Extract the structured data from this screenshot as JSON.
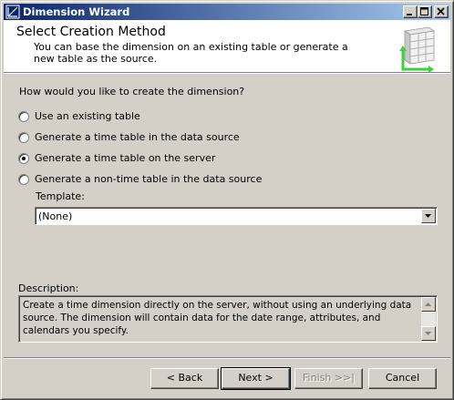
{
  "window": {
    "title": "Dimension Wizard",
    "title_gradient_start": "#0a246a",
    "title_gradient_end": "#a6caf0",
    "icons": [
      "app-icon",
      "minimize-icon",
      "maximize-icon",
      "close-icon"
    ]
  },
  "header": {
    "title": "Select Creation Method",
    "subtitle": "You can base the dimension on an existing table or generate a new table as the source.",
    "icon": "table-wizard-icon"
  },
  "main": {
    "question": "How would you like to create the dimension?",
    "options": [
      {
        "label": "Use an existing table",
        "checked": false
      },
      {
        "label": "Generate a time table in the data source",
        "checked": false
      },
      {
        "label": "Generate a time table on the server",
        "checked": true
      },
      {
        "label": "Generate a non-time table in the data source",
        "checked": false
      }
    ],
    "template_label": "Template:",
    "template_value": "(None)",
    "description_label": "Description:",
    "description_text": "Create a time dimension directly on the server, without using an underlying data source. The dimension will contain data for the date range, attributes, and calendars you specify."
  },
  "buttons": {
    "back": "< Back",
    "next": "Next >",
    "finish": "Finish >>|",
    "cancel": "Cancel"
  }
}
